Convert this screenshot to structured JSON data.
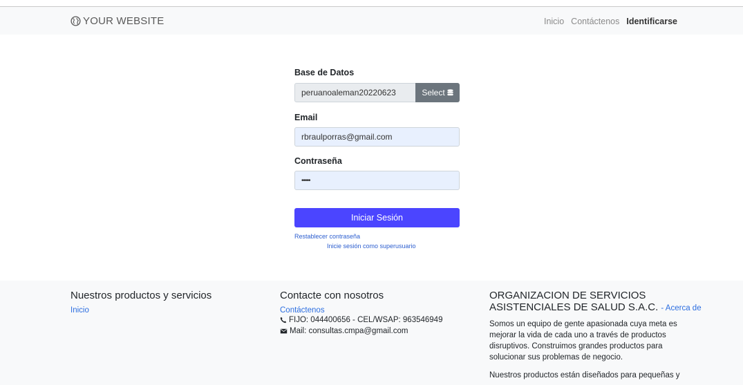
{
  "navbar": {
    "brand": "YOUR WEBSITE",
    "links": [
      "Inicio",
      "Contáctenos",
      "Identificarse"
    ]
  },
  "form": {
    "db_label": "Base de Datos",
    "db_value": "peruanoaleman20220623",
    "select_label": "Select",
    "email_label": "Email",
    "email_value": "rbraulporras@gmail.com",
    "password_label": "Contraseña",
    "password_value": "•••••",
    "login_button": "Iniciar Sesión",
    "reset_link": "Restablecer contraseña",
    "superuser_link": "Inicie sesión como superusuario"
  },
  "footer": {
    "col1": {
      "heading": "Nuestros productos y servicios",
      "link": "Inicio"
    },
    "col2": {
      "heading": "Contacte con nosotros",
      "link": "Contáctenos",
      "phone": "FIJO: 044400656 - CEL/WSAP: 963546949",
      "mail": "Mail: consultas.cmpa@gmail.com"
    },
    "col3": {
      "heading_line1": "ORGANIZACION DE SERVICIOS",
      "heading_line2": "ASISTENCIALES DE SALUD S.A.C.",
      "about_link": "- Acerca de",
      "para1_lines": [
        "Somos un equipo de gente apasionada cuya meta es",
        "mejorar la vida de cada uno a través de productos",
        "disruptivos. Construimos grandes productos para",
        "solucionar sus problemas de negocio."
      ],
      "para2_line": "Nuestros productos están diseñados para pequeñas y"
    }
  },
  "icons": [
    "globe-icon",
    "database-icon",
    "phone-icon",
    "envelope-icon"
  ]
}
